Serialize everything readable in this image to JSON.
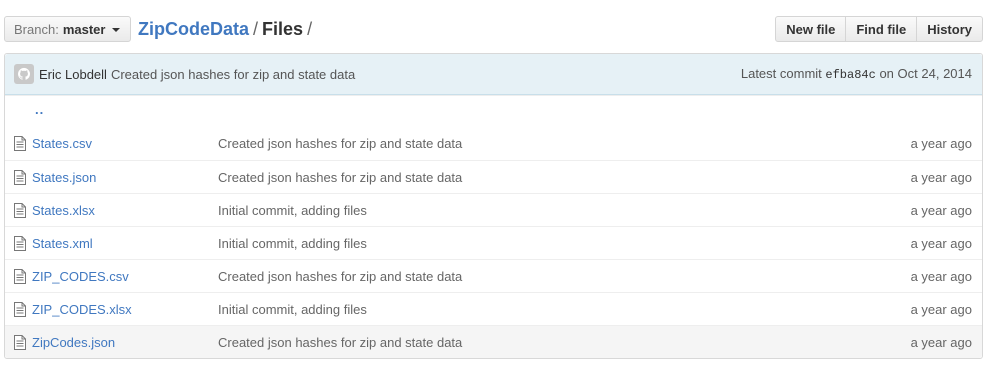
{
  "branch": {
    "prefix": "Branch:",
    "name": "master"
  },
  "breadcrumb": {
    "repo": "ZipCodeData",
    "sep1": "/",
    "current": "Files",
    "sep2": "/"
  },
  "actions": {
    "new_file": "New file",
    "find_file": "Find file",
    "history": "History"
  },
  "commit": {
    "author": "Eric Lobdell",
    "message": "Created json hashes for zip and state data",
    "latest_label": "Latest commit",
    "sha": "efba84c",
    "on_label": "on",
    "date": "Oct 24, 2014"
  },
  "up_dir": "..",
  "files": [
    {
      "name": "States.csv",
      "message": "Created json hashes for zip and state data",
      "age": "a year ago"
    },
    {
      "name": "States.json",
      "message": "Created json hashes for zip and state data",
      "age": "a year ago"
    },
    {
      "name": "States.xlsx",
      "message": "Initial commit, adding files",
      "age": "a year ago"
    },
    {
      "name": "States.xml",
      "message": "Initial commit, adding files",
      "age": "a year ago"
    },
    {
      "name": "ZIP_CODES.csv",
      "message": "Created json hashes for zip and state data",
      "age": "a year ago"
    },
    {
      "name": "ZIP_CODES.xlsx",
      "message": "Initial commit, adding files",
      "age": "a year ago"
    },
    {
      "name": "ZipCodes.json",
      "message": "Created json hashes for zip and state data",
      "age": "a year ago"
    }
  ],
  "colors": {
    "link": "#4078c0",
    "commit_bar": "#e6f1f6",
    "row_hover": "#f5f5f5"
  },
  "icons": {
    "file": "file-text-icon",
    "avatar": "github-octocat-icon",
    "caret": "caret-down-icon"
  }
}
